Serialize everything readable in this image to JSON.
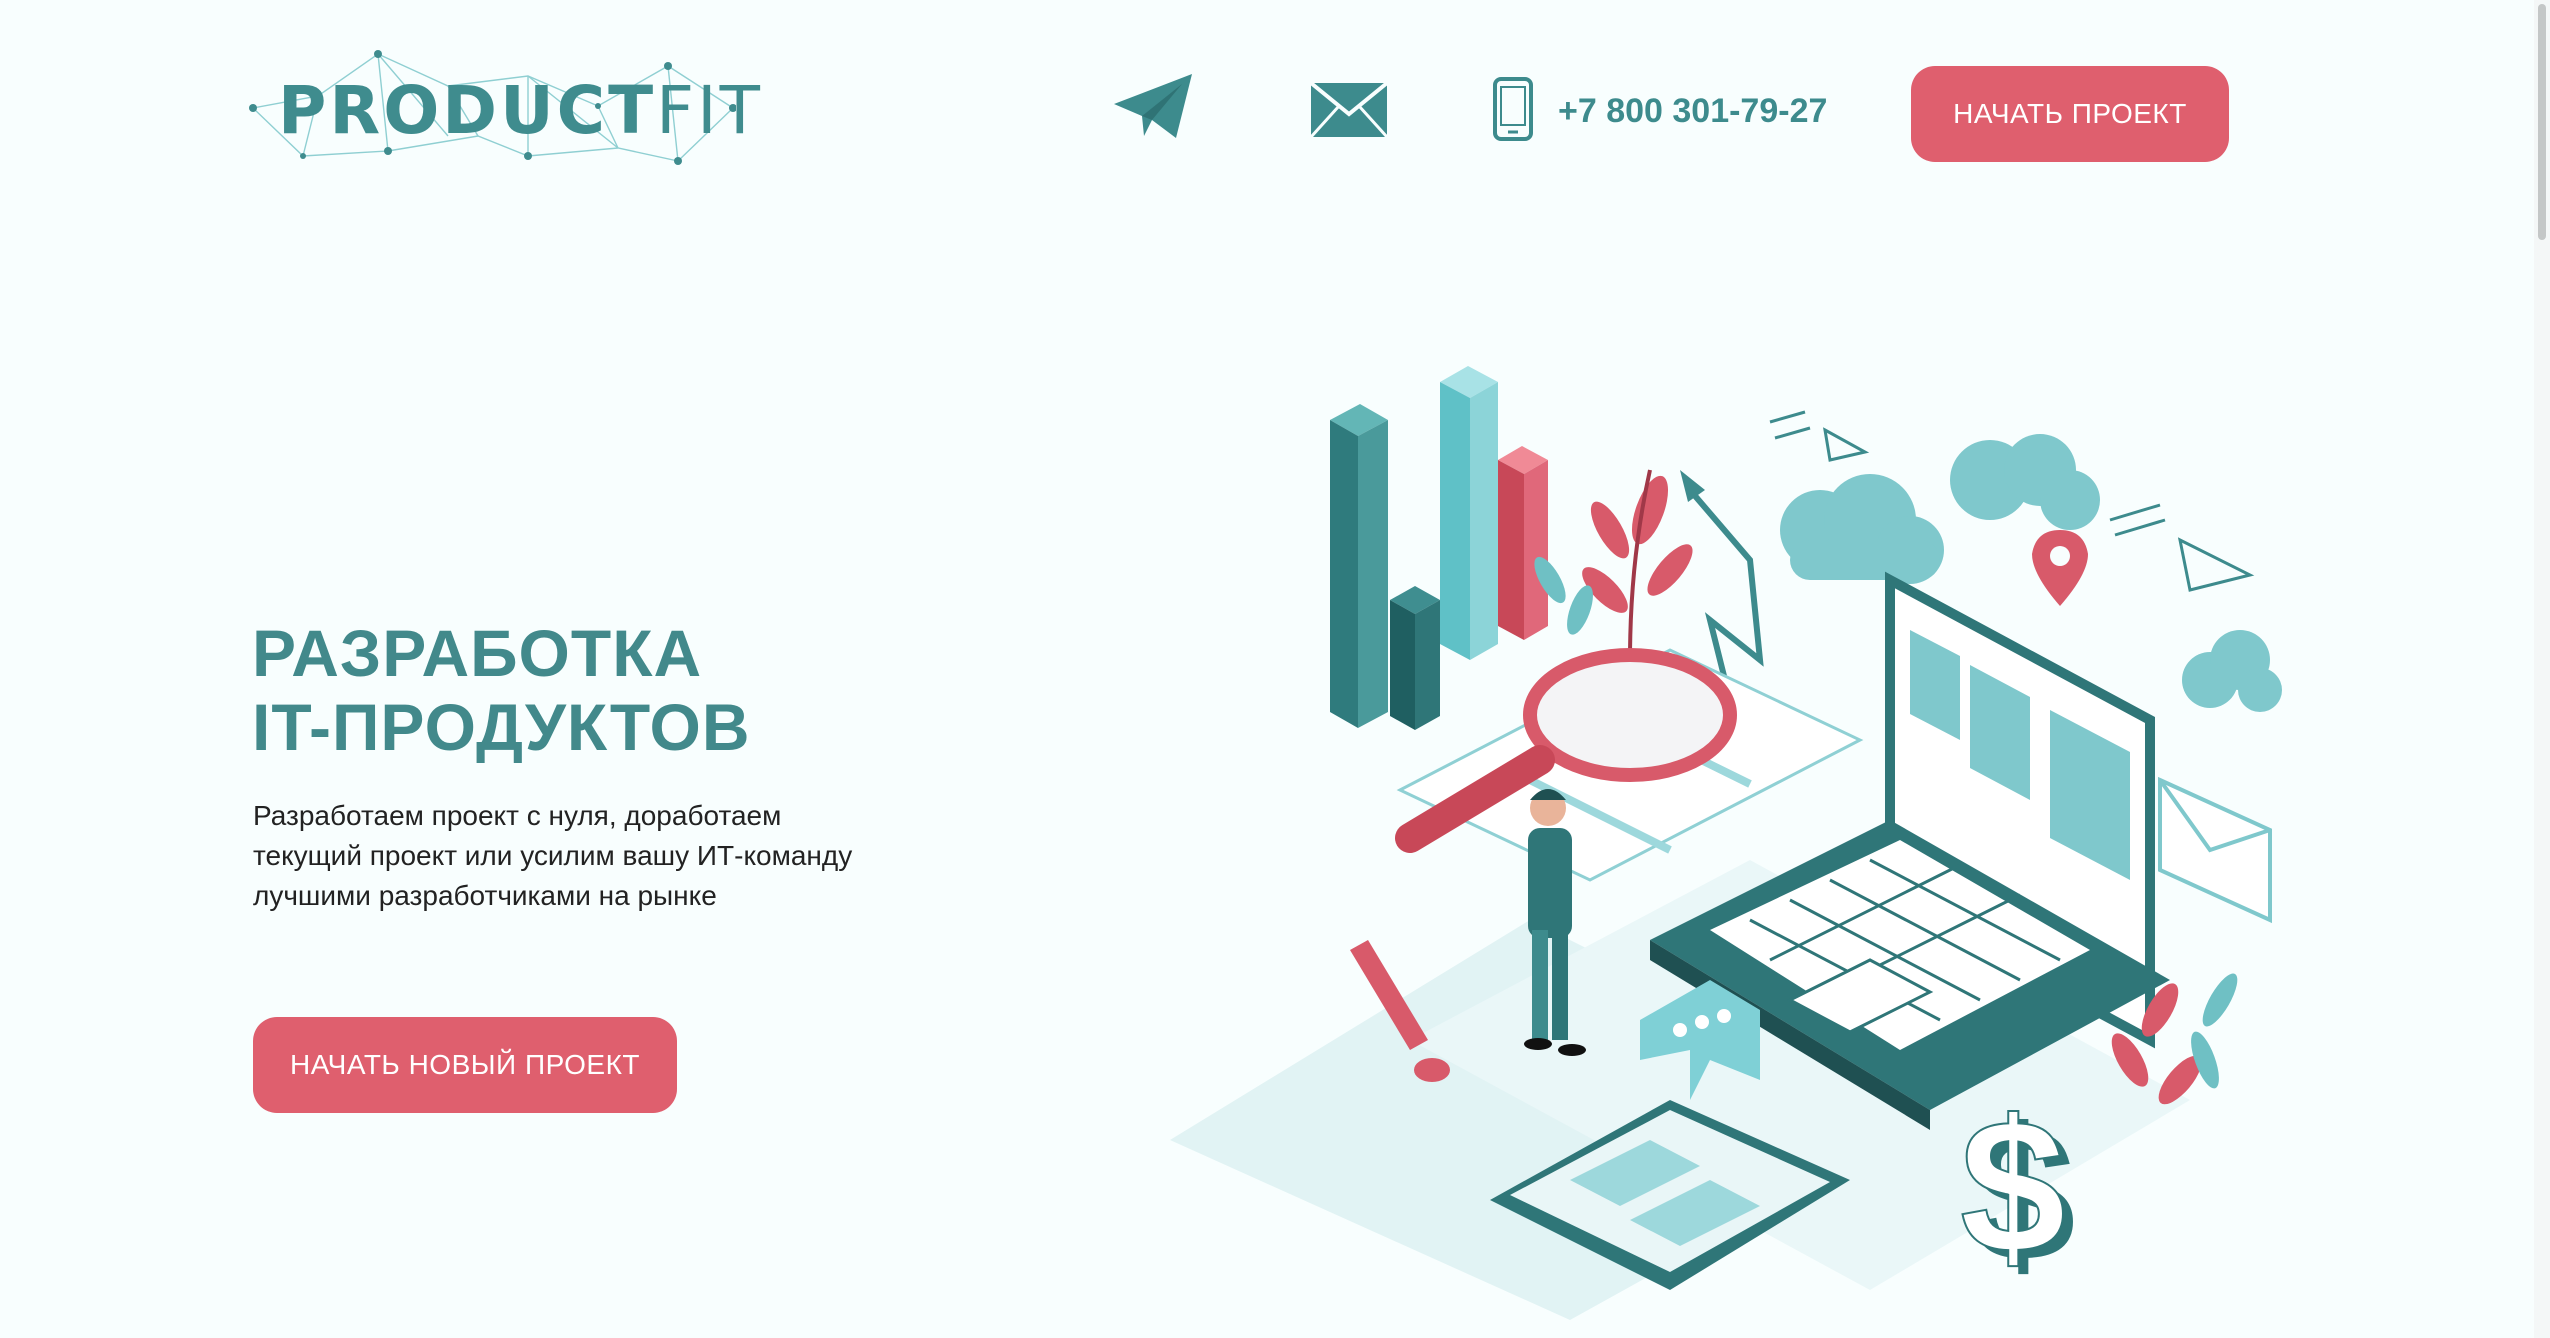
{
  "header": {
    "logo": {
      "text_bold": "PRODUCT",
      "text_light": "FIT"
    },
    "icons": {
      "telegram": "telegram-icon",
      "mail": "mail-icon",
      "phone": "phone-icon"
    },
    "phone": "+7 800 301-79-27",
    "cta_label": "НАЧАТЬ ПРОЕКТ"
  },
  "hero": {
    "title_line1": "РАЗРАБОТКА",
    "title_line2": "IT-ПРОДУКТОВ",
    "desc_line1": "Разработаем проект с нуля, доработаем",
    "desc_line2": "текущий проект или усилим вашу ИТ-команду",
    "desc_line3": "лучшими разработчиками на рынке",
    "cta_label": "НАЧАТЬ НОВЫЙ ПРОЕКТ"
  },
  "colors": {
    "background": "#f8fefe",
    "teal": "#3f8c8e",
    "accent": "#df5f6e"
  }
}
